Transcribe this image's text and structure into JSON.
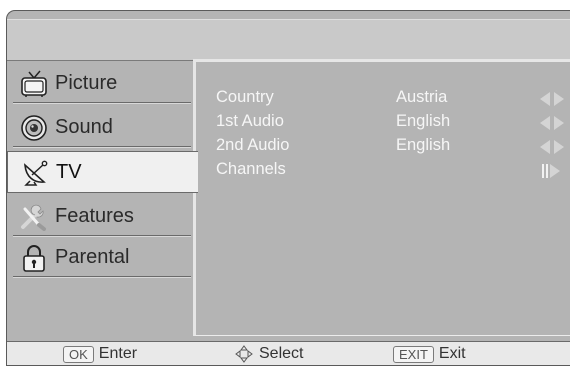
{
  "menu": {
    "items": [
      {
        "label": "Picture",
        "icon": "tv-icon",
        "selected": false
      },
      {
        "label": "Sound",
        "icon": "speaker-icon",
        "selected": false
      },
      {
        "label": "TV",
        "icon": "satellite-dish-icon",
        "selected": true
      },
      {
        "label": "Features",
        "icon": "wrench-screwdriver-icon",
        "selected": false
      },
      {
        "label": "Parental",
        "icon": "lock-icon",
        "selected": false
      }
    ]
  },
  "settings": {
    "rows": [
      {
        "label": "Country",
        "value": "Austria",
        "control": "left-right-arrows"
      },
      {
        "label": "1st Audio",
        "value": "English",
        "control": "left-right-arrows"
      },
      {
        "label": "2nd Audio",
        "value": "English",
        "control": "left-right-arrows"
      },
      {
        "label": "Channels",
        "value": "",
        "control": "enter-arrow"
      }
    ]
  },
  "footer": {
    "ok_key": "OK",
    "ok_label": "Enter",
    "select_label": "Select",
    "exit_key": "EXIT",
    "exit_label": "Exit"
  },
  "colors": {
    "panel": "#b4b4b4",
    "selected_tab": "#f0f0f0",
    "footer": "#e9e9e9",
    "text_light": "#f6f6f6"
  }
}
